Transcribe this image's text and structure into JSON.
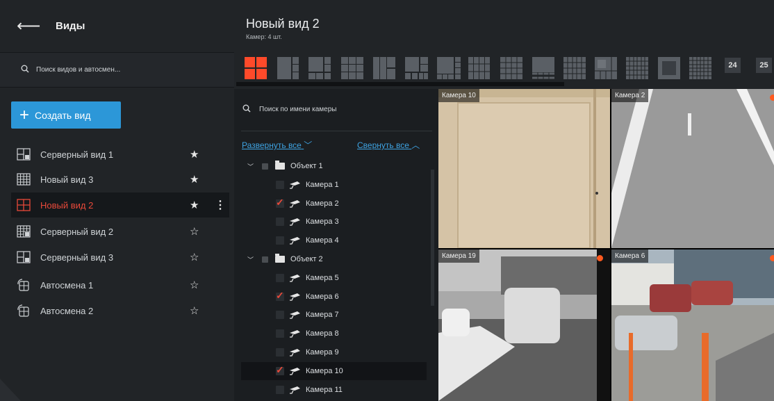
{
  "sidebar": {
    "back_icon": "arrow-left-icon",
    "title": "Виды",
    "search_placeholder": "Поиск видов и автосмен...",
    "create_button": "Создать вид",
    "views": [
      {
        "label": "Серверный вид 1",
        "icon": "server-layout-icon",
        "favorite": true
      },
      {
        "label": "Новый вид 3",
        "icon": "grid-4x4-icon",
        "favorite": true
      },
      {
        "label": "Новый вид 2",
        "icon": "grid-2x2-icon",
        "favorite": true,
        "active": true
      },
      {
        "label": "Серверный вид 2",
        "icon": "server-grid-icon",
        "favorite": false
      },
      {
        "label": "Серверный вид 3",
        "icon": "server-layout-icon",
        "favorite": false
      },
      {
        "label": "Автосмена 1",
        "icon": "autoswitch-icon",
        "favorite": false
      },
      {
        "label": "Автосмена 2",
        "icon": "autoswitch-icon",
        "favorite": false
      }
    ],
    "star_filled": "★",
    "star_empty": "☆",
    "kebab": "⋮"
  },
  "header": {
    "title": "Новый вид 2",
    "subtitle": "Камер: 4 шт.",
    "layout_numbers": [
      "24",
      "25"
    ],
    "accent_color": "#e8493a"
  },
  "tree": {
    "search_placeholder": "Поиск по имени камеры",
    "expand_all": "Развернуть все",
    "collapse_all": "Свернуть все",
    "nodes": [
      {
        "type": "group",
        "label": "Объект 1"
      },
      {
        "type": "camera",
        "label": "Камера 1",
        "checked": false
      },
      {
        "type": "camera",
        "label": "Камера 2",
        "checked": true
      },
      {
        "type": "camera",
        "label": "Камера 3",
        "checked": false
      },
      {
        "type": "camera",
        "label": "Камера 4",
        "checked": false
      },
      {
        "type": "group",
        "label": "Объект 2"
      },
      {
        "type": "camera",
        "label": "Камера 5",
        "checked": false
      },
      {
        "type": "camera",
        "label": "Камера 6",
        "checked": true
      },
      {
        "type": "camera",
        "label": "Камера 7",
        "checked": false
      },
      {
        "type": "camera",
        "label": "Камера 8",
        "checked": false
      },
      {
        "type": "camera",
        "label": "Камера 9",
        "checked": false
      },
      {
        "type": "camera",
        "label": "Камера 10",
        "checked": true
      },
      {
        "type": "camera",
        "label": "Камера 11",
        "checked": false
      }
    ]
  },
  "grid": {
    "tiles": [
      {
        "label": "Камера 10",
        "recording": false
      },
      {
        "label": "Камера 2",
        "recording": true
      },
      {
        "label": "Камера 19",
        "recording": true
      },
      {
        "label": "Камера 6",
        "recording": true
      }
    ]
  }
}
